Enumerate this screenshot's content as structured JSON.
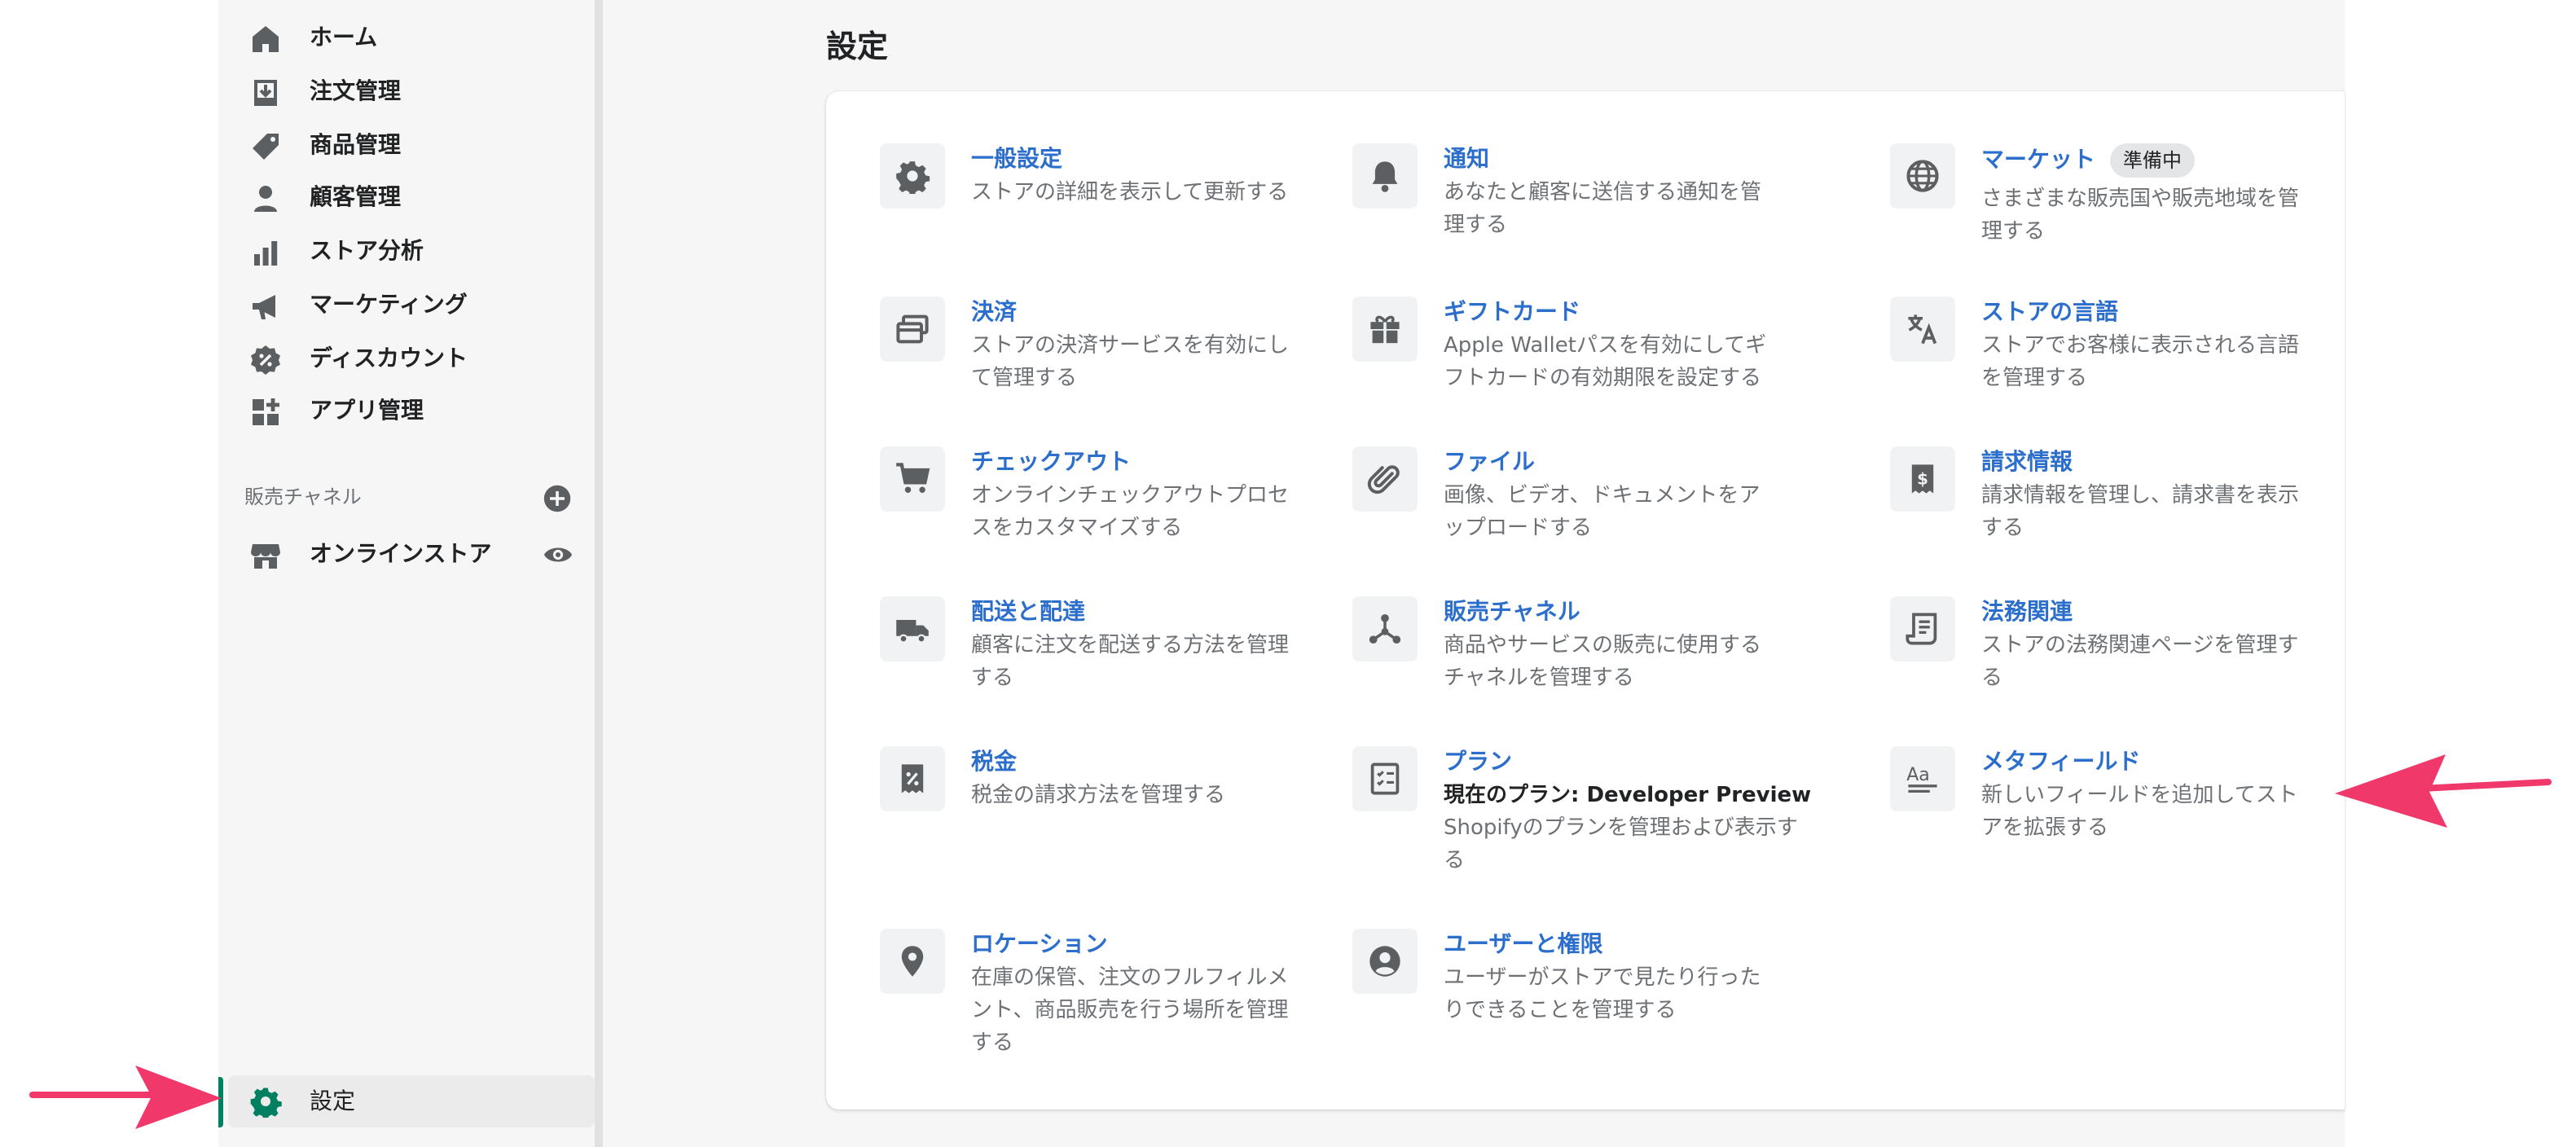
{
  "sidebar": {
    "items": [
      {
        "label": "ホーム",
        "icon": "home-icon"
      },
      {
        "label": "注文管理",
        "icon": "orders-icon"
      },
      {
        "label": "商品管理",
        "icon": "tag-icon"
      },
      {
        "label": "顧客管理",
        "icon": "customer-icon"
      },
      {
        "label": "ストア分析",
        "icon": "analytics-icon"
      },
      {
        "label": "マーケティング",
        "icon": "megaphone-icon"
      },
      {
        "label": "ディスカウント",
        "icon": "discount-icon"
      },
      {
        "label": "アプリ管理",
        "icon": "apps-icon"
      }
    ],
    "channels_header": "販売チャネル",
    "online_store": "オンラインストア",
    "settings": "設定"
  },
  "page": {
    "title": "設定"
  },
  "settings": [
    {
      "title": "一般設定",
      "desc": "ストアの詳細を表示して更新する",
      "icon": "gear-icon"
    },
    {
      "title": "通知",
      "desc": "あなたと顧客に送信する通知を管理する",
      "icon": "bell-icon"
    },
    {
      "title": "マーケット",
      "badge": "準備中",
      "desc": "さまざまな販売国や販売地域を管理する",
      "icon": "globe-icon"
    },
    {
      "title": "決済",
      "desc": "ストアの決済サービスを有効にして管理する",
      "icon": "payment-icon"
    },
    {
      "title": "ギフトカード",
      "desc": "Apple Walletパスを有効にしてギフトカードの有効期限を設定する",
      "icon": "gift-icon"
    },
    {
      "title": "ストアの言語",
      "desc": "ストアでお客様に表示される言語を管理する",
      "icon": "translate-icon"
    },
    {
      "title": "チェックアウト",
      "desc": "オンラインチェックアウトプロセスをカスタマイズする",
      "icon": "cart-icon"
    },
    {
      "title": "ファイル",
      "desc": "画像、ビデオ、ドキュメントをアップロードする",
      "icon": "paperclip-icon"
    },
    {
      "title": "請求情報",
      "desc": "請求情報を管理し、請求書を表示する",
      "icon": "billing-icon"
    },
    {
      "title": "配送と配達",
      "desc": "顧客に注文を配送する方法を管理する",
      "icon": "truck-icon"
    },
    {
      "title": "販売チャネル",
      "desc": "商品やサービスの販売に使用するチャネルを管理する",
      "icon": "channels-icon"
    },
    {
      "title": "法務関連",
      "desc": "ストアの法務関連ページを管理する",
      "icon": "legal-icon"
    },
    {
      "title": "税金",
      "desc": "税金の請求方法を管理する",
      "icon": "tax-icon"
    },
    {
      "title": "プラン",
      "plan_current": "現在のプラン: Developer Preview",
      "desc": "Shopifyのプランを管理および表示する",
      "icon": "plan-icon"
    },
    {
      "title": "メタフィールド",
      "desc": "新しいフィールドを追加してストアを拡張する",
      "icon": "metafields-icon"
    },
    {
      "title": "ロケーション",
      "desc": "在庫の保管、注文のフルフィルメント、商品販売を行う場所を管理する",
      "icon": "location-icon"
    },
    {
      "title": "ユーザーと権限",
      "desc": "ユーザーがストアで見たり行ったりできることを管理する",
      "icon": "user-icon"
    }
  ],
  "colors": {
    "accent_green": "#008060",
    "link_blue": "#2c6ecb",
    "annotation_arrow": "#f0386b"
  }
}
